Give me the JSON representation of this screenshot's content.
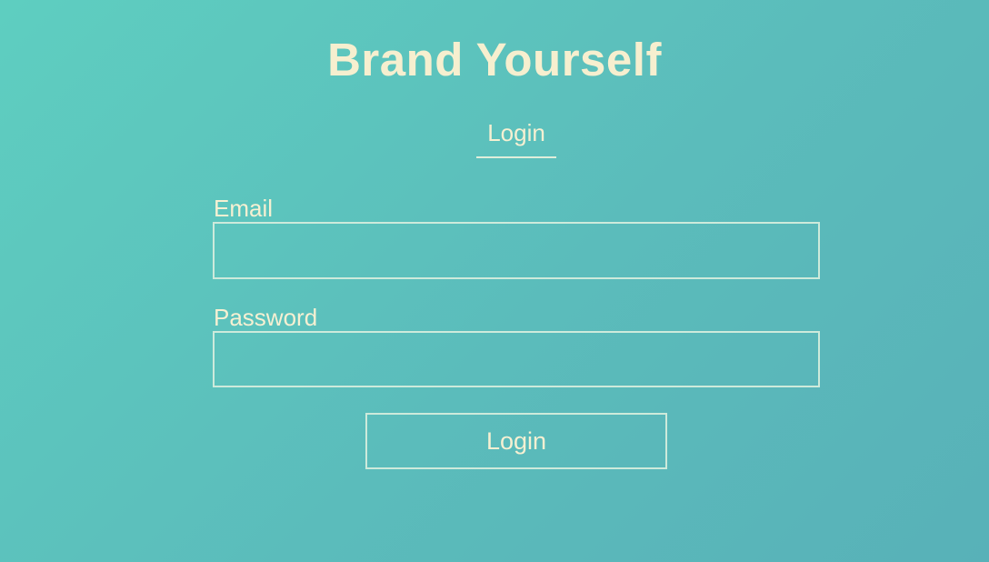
{
  "header": {
    "title": "Brand Yourself"
  },
  "tabs": [
    {
      "label": "Login",
      "active": true
    }
  ],
  "form": {
    "email": {
      "label": "Email",
      "value": "",
      "placeholder": ""
    },
    "password": {
      "label": "Password",
      "value": "",
      "placeholder": ""
    },
    "submit_label": "Login"
  },
  "colors": {
    "background_start": "#5ecec0",
    "background_end": "#58b1b8",
    "text": "#f6f0d2",
    "border": "#cdeadb"
  }
}
